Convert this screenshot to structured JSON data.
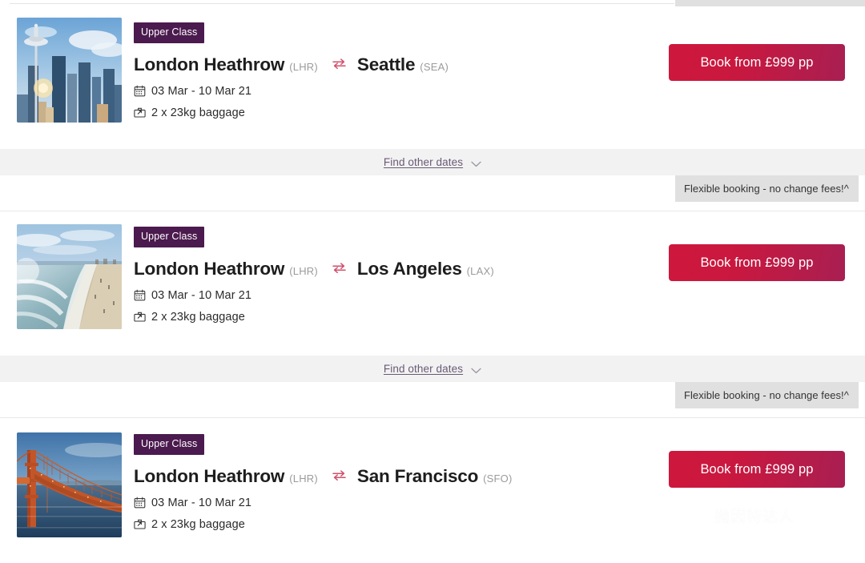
{
  "colors": {
    "badge_purple": "#4b1a4e",
    "button_gradient_start": "#cf173c",
    "button_gradient_end": "#a81f52",
    "swap_arrow": "#d1506b",
    "band_gray": "#f2f2f2",
    "flex_badge_gray": "#e0e0e0",
    "link_purple": "#6a5a76"
  },
  "flights": [
    {
      "cabin": "Upper Class",
      "origin": "London Heathrow",
      "origin_code": "(LHR)",
      "destination": "Seattle",
      "destination_code": "(SEA)",
      "dates": "03 Mar - 10 Mar 21",
      "baggage": "2 x 23kg baggage",
      "price_label": "Book from £999 pp",
      "thumb_alt": "seattle-skyline-space-needle"
    },
    {
      "cabin": "Upper Class",
      "origin": "London Heathrow",
      "origin_code": "(LHR)",
      "destination": "Los Angeles",
      "destination_code": "(LAX)",
      "dates": "03 Mar - 10 Mar 21",
      "baggage": "2 x 23kg baggage",
      "price_label": "Book from £999 pp",
      "thumb_alt": "los-angeles-beach"
    },
    {
      "cabin": "Upper Class",
      "origin": "London Heathrow",
      "origin_code": "(LHR)",
      "destination": "San Francisco",
      "destination_code": "(SFO)",
      "dates": "03 Mar - 10 Mar 21",
      "baggage": "2 x 23kg baggage",
      "price_label": "Book from £999 pp",
      "thumb_alt": "san-francisco-golden-gate-bridge"
    }
  ],
  "find_other_dates": {
    "label": "Find other dates",
    "chevron": "chevron-down"
  },
  "flexible_booking": {
    "label": "Flexible booking - no change fees!^"
  },
  "watermark": {
    "text": "抛因特达人",
    "icon": "wechat-icon"
  }
}
